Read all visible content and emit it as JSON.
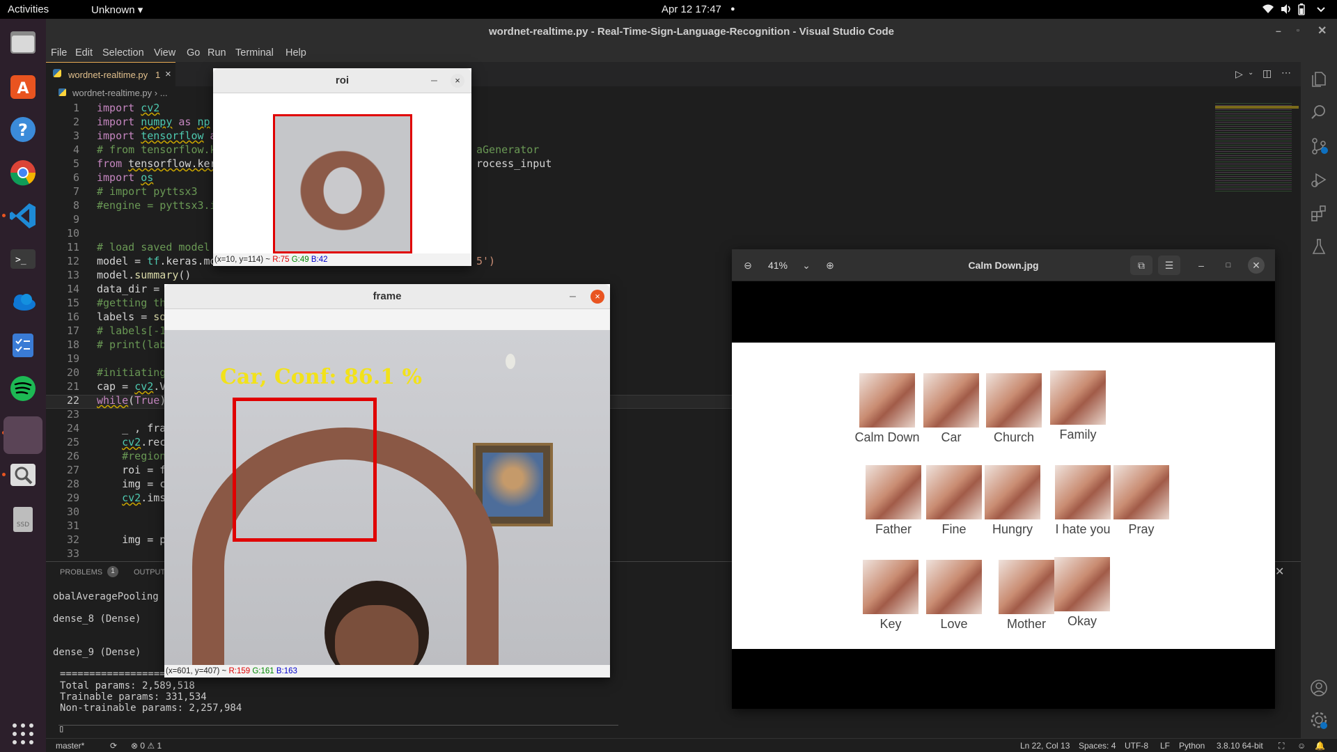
{
  "topbar": {
    "activities": "Activities",
    "app_menu": "Unknown ▾",
    "datetime": "Apr 12  17:47",
    "dot": "●"
  },
  "vscode": {
    "title": "wordnet-realtime.py - Real-Time-Sign-Language-Recognition - Visual Studio Code",
    "menu": [
      "File",
      "Edit",
      "Selection",
      "View",
      "Go",
      "Run",
      "Terminal",
      "Help"
    ],
    "tab": {
      "name": "wordnet-realtime.py",
      "badge": "1",
      "close": "×"
    },
    "breadcrumb": "wordnet-realtime.py › ...",
    "line_numbers": [
      "1",
      "2",
      "3",
      "4",
      "5",
      "6",
      "7",
      "8",
      "9",
      "10",
      "11",
      "12",
      "13",
      "14",
      "15",
      "16",
      "17",
      "18",
      "19",
      "20",
      "21",
      "22",
      "23",
      "24",
      "25",
      "26",
      "27",
      "28",
      "29",
      "30",
      "31",
      "32",
      "33"
    ],
    "code": {
      "l1": "import cv2",
      "l2": "import numpy as np",
      "l3": "import tensorflow a",
      "l4a": "# from tensorflow.k",
      "l4b": "aGenerator",
      "l5a": "from tensorflow.ker",
      "l5b": "rocess_input",
      "l6": "import os",
      "l7": "# import pyttsx3",
      "l8": "#engine = pyttsx3.i",
      "l11": "# load saved model",
      "l12a": "model = tf.keras.mo",
      "l12b": "5')",
      "l13": "model.summary()",
      "l14": "data_dir = ",
      "l15": "#getting th",
      "l16": "labels = so",
      "l17": "# labels[-1",
      "l18": "# print(lab",
      "l20": "#initiating",
      "l21": "cap = cv2.V",
      "l22": "while(True)",
      "l24": "    _ , fra",
      "l25": "    cv2.rec",
      "l26": "    #region",
      "l27": "    roi = f",
      "l28": "    img = c",
      "l29": "    cv2.ims",
      "l32": "    img = p"
    },
    "panel": {
      "problems": "PROBLEMS",
      "problems_count": "1",
      "output": "OUTPUT",
      "lines": [
        "obalAveragePooling",
        "dense_8 (Dense)",
        "dense_9 (Dense)",
        "==================",
        "Total params: 2,589,518",
        "Trainable params: 331,534",
        "Non-trainable params: 2,257,984"
      ],
      "cursor": "▯"
    },
    "status": {
      "branch": "master*",
      "sync": "⟳",
      "errors": "⊗ 0 ⚠ 1",
      "position": "Ln 22, Col 13",
      "spaces": "Spaces: 4",
      "encoding": "UTF-8",
      "eol": "LF",
      "language": "Python",
      "interpreter": "3.8.10 64-bit"
    }
  },
  "roi_window": {
    "title": "roi",
    "min": "–",
    "close": "×",
    "status": {
      "coords": "(x=10, y=114) ~ ",
      "r": "R:75",
      "g": "G:49",
      "b": "B:42"
    }
  },
  "frame_window": {
    "title": "frame",
    "min": "–",
    "close": "×",
    "overlay_text": "Car, Conf: 86.1 %",
    "status": {
      "coords": "(x=601, y=407) ~ ",
      "r": "R:159",
      "g": "G:161",
      "b": "B:163"
    }
  },
  "image_viewer": {
    "title": "Calm Down.jpg",
    "zoom": "41%",
    "signs": [
      "Calm Down",
      "Car",
      "Church",
      "Family",
      "Father",
      "Fine",
      "Hungry",
      "I hate you",
      "Pray",
      "Key",
      "Love",
      "Mother",
      "Okay"
    ]
  },
  "colors": {
    "accent_red": "#e00000",
    "overlay_yellow": "#f2e21a",
    "vscode_bg": "#1e1e1e",
    "dock_bg": "#2c1f2b"
  }
}
